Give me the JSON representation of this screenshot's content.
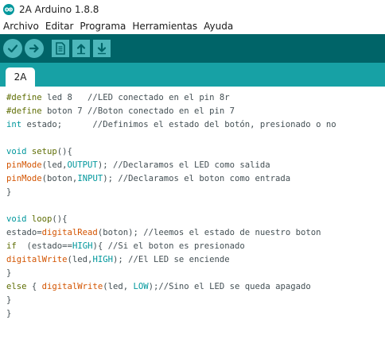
{
  "window": {
    "title": "2A Arduino 1.8.8",
    "icon": "arduino-logo-icon"
  },
  "menu": {
    "items": [
      "Archivo",
      "Editar",
      "Programa",
      "Herramientas",
      "Ayuda"
    ]
  },
  "toolbar": {
    "buttons": [
      {
        "name": "verify",
        "icon": "checkmark-icon"
      },
      {
        "name": "upload",
        "icon": "arrow-right-icon"
      },
      {
        "name": "new",
        "icon": "new-file-icon"
      },
      {
        "name": "open",
        "icon": "arrow-up-icon"
      },
      {
        "name": "save",
        "icon": "arrow-down-icon"
      }
    ]
  },
  "tabs": [
    {
      "label": "2A",
      "active": true
    }
  ],
  "colors": {
    "toolbar_bg": "#006468",
    "tabbar_bg": "#17a1a5",
    "button_bg": "#4db7bb",
    "keyword": "#5e6d03",
    "type": "#00979c",
    "function": "#d35400",
    "text": "#434f54"
  },
  "code": {
    "lines": [
      [
        {
          "t": "#define",
          "c": "kw"
        },
        {
          "t": " led 8   //LED conectado en el pin 8r",
          "c": ""
        }
      ],
      [
        {
          "t": "#define",
          "c": "kw"
        },
        {
          "t": " boton 7 //Boton conectado en el pin 7",
          "c": ""
        }
      ],
      [
        {
          "t": "int",
          "c": "ty"
        },
        {
          "t": " estado;      //Definimos el estado del botón, presionado o no",
          "c": ""
        }
      ],
      [],
      [
        {
          "t": "void",
          "c": "ty"
        },
        {
          "t": " ",
          "c": ""
        },
        {
          "t": "setup",
          "c": "kw"
        },
        {
          "t": "(){",
          "c": ""
        }
      ],
      [
        {
          "t": "pinMode",
          "c": "fn"
        },
        {
          "t": "(led,",
          "c": ""
        },
        {
          "t": "OUTPUT",
          "c": "k2"
        },
        {
          "t": "); //Declaramos el LED como salida",
          "c": ""
        }
      ],
      [
        {
          "t": "pinMode",
          "c": "fn"
        },
        {
          "t": "(boton,",
          "c": ""
        },
        {
          "t": "INPUT",
          "c": "k2"
        },
        {
          "t": "); //Declaramos el boton como entrada",
          "c": ""
        }
      ],
      [
        {
          "t": "}",
          "c": ""
        }
      ],
      [],
      [
        {
          "t": "void",
          "c": "ty"
        },
        {
          "t": " ",
          "c": ""
        },
        {
          "t": "loop",
          "c": "kw"
        },
        {
          "t": "(){",
          "c": ""
        }
      ],
      [
        {
          "t": "estado=",
          "c": ""
        },
        {
          "t": "digitalRead",
          "c": "fn"
        },
        {
          "t": "(boton); //leemos el estado de nuestro boton",
          "c": ""
        }
      ],
      [
        {
          "t": "if",
          "c": "kw"
        },
        {
          "t": "  (estado==",
          "c": ""
        },
        {
          "t": "HIGH",
          "c": "k2"
        },
        {
          "t": "){ //Si el boton es presionado",
          "c": ""
        }
      ],
      [
        {
          "t": "digitalWrite",
          "c": "fn"
        },
        {
          "t": "(led,",
          "c": ""
        },
        {
          "t": "HIGH",
          "c": "k2"
        },
        {
          "t": "); //El LED se enciende",
          "c": ""
        }
      ],
      [
        {
          "t": "}",
          "c": ""
        }
      ],
      [
        {
          "t": "else",
          "c": "kw"
        },
        {
          "t": " { ",
          "c": ""
        },
        {
          "t": "digitalWrite",
          "c": "fn"
        },
        {
          "t": "(led, ",
          "c": ""
        },
        {
          "t": "LOW",
          "c": "k2"
        },
        {
          "t": ");//Sino el LED se queda apagado",
          "c": ""
        }
      ],
      [
        {
          "t": "}",
          "c": ""
        }
      ],
      [
        {
          "t": "}",
          "c": ""
        }
      ]
    ]
  }
}
